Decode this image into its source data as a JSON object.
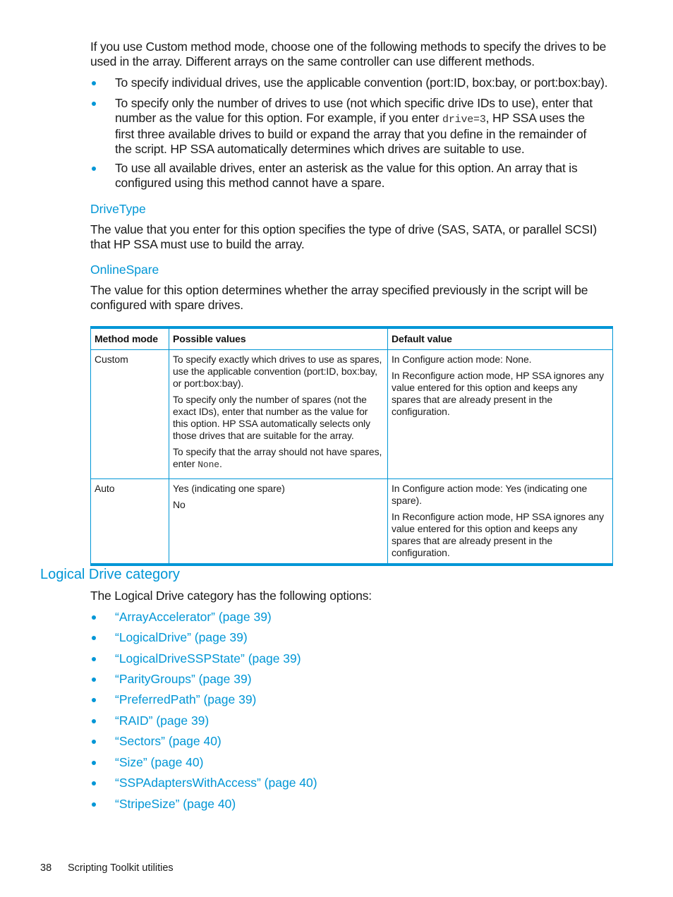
{
  "intro": {
    "paragraph": "If you use Custom method mode, choose one of the following methods to specify the drives to be used in the array. Different arrays on the same controller can use different methods.",
    "paragraph_lines": [
      "If you use Custom method mode, choose one of the following methods to specify the drives to be",
      "used in the array. Different arrays on the same controller can use different methods."
    ],
    "bullets": [
      {
        "lines": [
          "To specify individual drives, use the applicable convention (port:ID, box:bay, or port:box:bay)."
        ]
      },
      {
        "line1": "To specify only the number of drives to use (not which specific drive IDs to use), enter that",
        "line2_before": "number as the value for this option. For example, if you enter ",
        "line2_code": "drive=3",
        "line2_after": ", HP SSA uses the",
        "line3": "first three available drives to build or expand the array that you define in the remainder of",
        "line4": "the script. HP SSA automatically determines which drives are suitable to use."
      },
      {
        "lines": [
          "To use all available drives, enter an asterisk as the value for this option. An array that is",
          "configured using this method cannot have a spare."
        ]
      }
    ]
  },
  "drivetype": {
    "heading": "DriveType",
    "lines": [
      "The value that you enter for this option specifies the type of drive (SAS, SATA, or parallel SCSI)",
      "that HP SSA must use to build the array."
    ]
  },
  "onlinespare": {
    "heading": "OnlineSpare",
    "lines": [
      "The value for this option determines whether the array specified previously in the script will be",
      "configured with spare drives."
    ]
  },
  "table": {
    "headers": [
      "Method mode",
      "Possible values",
      "Default value"
    ],
    "rows": [
      {
        "mode": "Custom",
        "values": [
          "To specify exactly which drives to use as spares, use the applicable convention (port:ID, box:bay, or port:box:bay).",
          "To specify only the number of spares (not the exact IDs), enter that number as the value for this option. HP SSA automatically selects only those drives that are suitable for the array."
        ],
        "values_last_before": "To specify that the array should not have spares, enter ",
        "values_last_code": "None",
        "values_last_after": ".",
        "defaults": [
          "In Configure action mode: None.",
          "In Reconfigure action mode, HP SSA ignores any value entered for this option and keeps any spares that are already present in the configuration."
        ]
      },
      {
        "mode": "Auto",
        "values": [
          "Yes (indicating one spare)",
          "No"
        ],
        "defaults": [
          "In Configure action mode: Yes (indicating one spare).",
          "In Reconfigure action mode, HP SSA ignores any value entered for this option and keeps any spares that are already present in the configuration."
        ]
      }
    ]
  },
  "logical_drive": {
    "heading": "Logical Drive category",
    "intro": "The Logical Drive category has the following options:",
    "links": [
      "“ArrayAccelerator” (page 39)",
      "“LogicalDrive” (page 39)",
      "“LogicalDriveSSPState” (page 39)",
      "“ParityGroups” (page 39)",
      "“PreferredPath” (page 39)",
      "“RAID” (page 39)",
      "“Sectors” (page 40)",
      "“Size” (page 40)",
      "“SSPAdaptersWithAccess” (page 40)",
      "“StripeSize” (page 40)"
    ]
  },
  "footer": {
    "page_number": "38",
    "section_title": "Scripting Toolkit utilities"
  },
  "colors": {
    "accent": "#0096d6",
    "text": "#1a1a1a"
  }
}
